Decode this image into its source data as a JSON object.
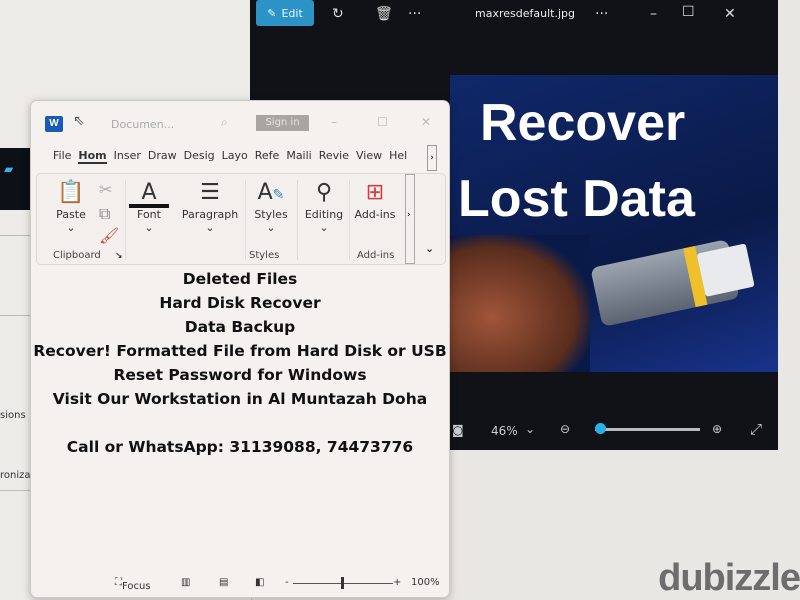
{
  "background_window": {
    "items": [
      "sions",
      "ronizati"
    ]
  },
  "photos": {
    "edit_label": "Edit",
    "file_name": "maxresdefault.jpg",
    "image_text": {
      "line1": "Recover",
      "line2": "Lost Data"
    },
    "zoom_level": "46%",
    "zoom_slider_fraction": 0.05,
    "accent": "#2c93c7"
  },
  "word": {
    "title": "Documen...",
    "sign_in": "Sign in",
    "tabs": [
      "File",
      "Hom",
      "Inser",
      "Draw",
      "Desig",
      "Layo",
      "Refe",
      "Maili",
      "Revie",
      "View",
      "Hel"
    ],
    "active_tab": "Hom",
    "ribbon": {
      "paste": "Paste",
      "font": "Font",
      "paragraph": "Paragraph",
      "styles": "Styles",
      "editing": "Editing",
      "addins": "Add-ins",
      "group_clipboard": "Clipboard",
      "group_styles": "Styles",
      "group_addins": "Add-ins"
    },
    "content": [
      "Deleted Files",
      "Hard Disk Recover",
      "Data Backup",
      "Recover! Formatted File from Hard Disk or USB",
      "Reset Password for Windows",
      "Visit Our Workstation in Al Muntazah Doha",
      "",
      "Call or WhatsApp: 31139088, 74473776"
    ],
    "status": {
      "focus": "Focus",
      "zoom": "100%",
      "minus": "-",
      "plus": "+"
    }
  },
  "watermark": "dubizzle"
}
